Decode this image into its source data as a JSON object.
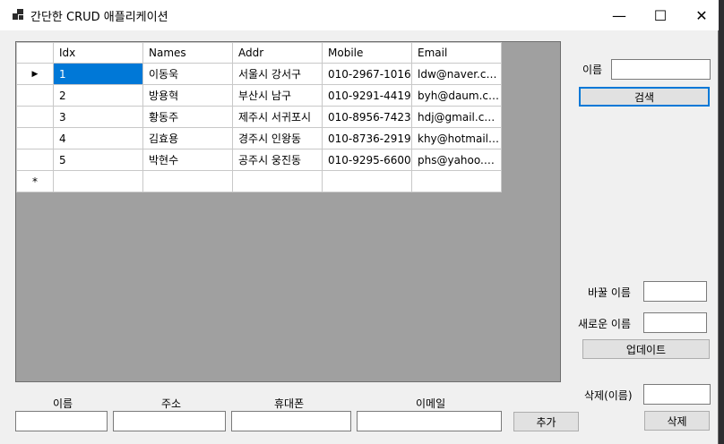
{
  "window": {
    "title": "간단한 CRUD 애플리케이션",
    "controls": {
      "minimize": "—",
      "maximize": "☐",
      "close": "✕"
    }
  },
  "grid": {
    "columns": [
      "Idx",
      "Names",
      "Addr",
      "Mobile",
      "Email"
    ],
    "rows": [
      [
        "1",
        "이동욱",
        "서울시 강서구",
        "010-2967-1016",
        "ldw@naver.com"
      ],
      [
        "2",
        "방용혁",
        "부산시 남구",
        "010-9291-4419",
        "byh@daum.com"
      ],
      [
        "3",
        "황동주",
        "제주시 서귀포시",
        "010-8956-7423",
        "hdj@gmail.com"
      ],
      [
        "4",
        "김효용",
        "경주시 인왕동",
        "010-8736-2919",
        "khy@hotmail.c..."
      ],
      [
        "5",
        "박현수",
        "공주시 웅진동",
        "010-9295-6600",
        "phs@yahoo.co...."
      ]
    ],
    "current_row_marker": "▶",
    "new_row_marker": "*"
  },
  "search": {
    "label": "이름",
    "value": "",
    "button": "검색"
  },
  "update": {
    "old_label": "바꿀 이름",
    "old_value": "",
    "new_label": "새로운 이름",
    "new_value": "",
    "button": "업데이트"
  },
  "delete": {
    "label": "삭제(이름)",
    "value": "",
    "button": "삭제"
  },
  "add": {
    "name_label": "이름",
    "addr_label": "주소",
    "mobile_label": "휴대폰",
    "email_label": "이메일",
    "button": "추가"
  },
  "colors": {
    "selection": "#0078d7",
    "grid_background": "#a0a0a0",
    "window_background": "#f0f0f0"
  }
}
